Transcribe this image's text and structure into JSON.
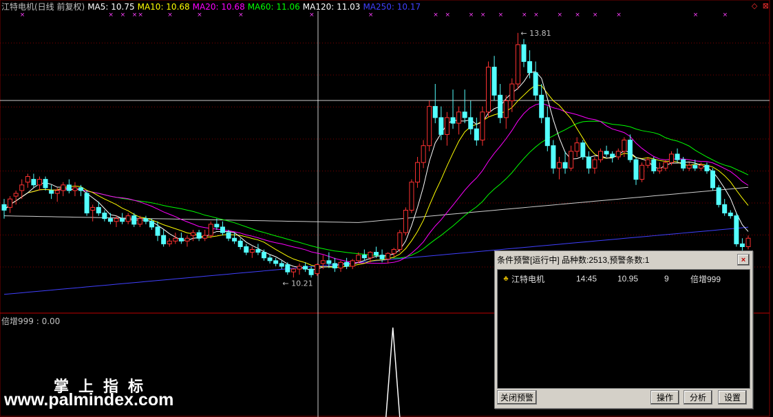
{
  "legend": {
    "stock": "江特电机(日线 前复权)",
    "ma": [
      {
        "label": "MA5: 10.75",
        "color": "#ffffff"
      },
      {
        "label": "MA10: 10.68",
        "color": "#ffff00"
      },
      {
        "label": "MA20: 10.68",
        "color": "#ff00ff"
      },
      {
        "label": "MA60: 11.06",
        "color": "#00ff00"
      },
      {
        "label": "MA120: 11.03",
        "color": "#ffffff"
      },
      {
        "label": "MA250: 10.17",
        "color": "#4040ff"
      }
    ]
  },
  "corner_icons": "◇ ⊠",
  "price_annotations": {
    "high": "13.81",
    "low": "10.21"
  },
  "sub_indicator": {
    "label": "倍增999 : 0.00"
  },
  "watermark": {
    "cn": "掌上指标",
    "url": "www.palmindex.com"
  },
  "alert_window": {
    "title": "条件预警[运行中] 品种数:2513,预警条数:1",
    "close_label": "×",
    "rows": [
      {
        "icon": "bell-icon",
        "name": "江特电机",
        "time": "14:45",
        "price": "10.95",
        "count": "9",
        "indicator": "倍增999"
      }
    ],
    "buttons": {
      "close_alert": "关闭预警",
      "operate": "操作",
      "analyze": "分析",
      "settings": "设置"
    }
  },
  "colors": {
    "up": "#ff3232",
    "down": "#54ffff",
    "background": "#000000",
    "grid": "#800000",
    "crosshair": "#ffffff"
  },
  "chart_data": {
    "type": "candlestick",
    "candles": [
      [
        10.75,
        10.85,
        10.5,
        10.65
      ],
      [
        10.7,
        10.9,
        10.6,
        10.85
      ],
      [
        10.9,
        11.0,
        10.75,
        10.95
      ],
      [
        11.0,
        11.2,
        10.85,
        11.1
      ],
      [
        11.15,
        11.3,
        11.05,
        11.25
      ],
      [
        11.2,
        11.3,
        11.05,
        11.1
      ],
      [
        11.1,
        11.25,
        11.0,
        11.2
      ],
      [
        11.2,
        11.25,
        11.0,
        11.05
      ],
      [
        11.0,
        11.1,
        10.85,
        10.95
      ],
      [
        10.95,
        11.05,
        10.8,
        11.0
      ],
      [
        11.0,
        11.15,
        10.9,
        11.1
      ],
      [
        11.1,
        11.2,
        10.95,
        11.0
      ],
      [
        11.0,
        11.15,
        10.9,
        11.05
      ],
      [
        11.05,
        11.1,
        10.9,
        11.0
      ],
      [
        10.95,
        11.0,
        10.55,
        10.6
      ],
      [
        10.65,
        10.75,
        10.45,
        10.7
      ],
      [
        10.7,
        10.8,
        10.55,
        10.6
      ],
      [
        10.6,
        10.65,
        10.45,
        10.5
      ],
      [
        10.5,
        10.6,
        10.4,
        10.45
      ],
      [
        10.45,
        10.55,
        10.35,
        10.5
      ],
      [
        10.5,
        10.6,
        10.4,
        10.45
      ],
      [
        10.45,
        10.6,
        10.4,
        10.55
      ],
      [
        10.55,
        10.6,
        10.35,
        10.4
      ],
      [
        10.4,
        10.55,
        10.35,
        10.5
      ],
      [
        10.5,
        10.55,
        10.4,
        10.45
      ],
      [
        10.45,
        10.5,
        10.3,
        10.35
      ],
      [
        10.35,
        10.45,
        10.1,
        10.2
      ],
      [
        10.2,
        10.3,
        10.0,
        10.05
      ],
      [
        10.05,
        10.15,
        10.0,
        10.1
      ],
      [
        10.1,
        10.25,
        10.05,
        10.15
      ],
      [
        10.15,
        10.25,
        10.05,
        10.1
      ],
      [
        10.1,
        10.2,
        10.0,
        10.15
      ],
      [
        10.2,
        10.3,
        10.1,
        10.25
      ],
      [
        10.25,
        10.3,
        10.1,
        10.15
      ],
      [
        10.15,
        10.3,
        10.1,
        10.2
      ],
      [
        10.2,
        10.45,
        10.15,
        10.4
      ],
      [
        10.4,
        10.5,
        10.3,
        10.35
      ],
      [
        10.35,
        10.45,
        10.2,
        10.25
      ],
      [
        10.25,
        10.3,
        10.1,
        10.15
      ],
      [
        10.15,
        10.25,
        10.05,
        10.1
      ],
      [
        10.1,
        10.15,
        9.95,
        10.0
      ],
      [
        10.0,
        10.05,
        9.85,
        9.9
      ],
      [
        9.9,
        10.0,
        9.8,
        9.95
      ],
      [
        9.95,
        10.05,
        9.85,
        9.9
      ],
      [
        9.9,
        9.95,
        9.75,
        9.8
      ],
      [
        9.8,
        9.85,
        9.7,
        9.75
      ],
      [
        9.75,
        9.8,
        9.65,
        9.7
      ],
      [
        9.7,
        9.75,
        9.6,
        9.65
      ],
      [
        9.68,
        9.72,
        9.5,
        9.55
      ],
      [
        9.55,
        9.62,
        9.45,
        9.6
      ],
      [
        9.6,
        9.7,
        9.5,
        9.65
      ],
      [
        9.65,
        9.72,
        9.55,
        9.6
      ],
      [
        9.6,
        9.65,
        9.45,
        9.5
      ],
      [
        9.52,
        9.7,
        9.48,
        9.68
      ],
      [
        9.7,
        9.85,
        9.6,
        9.75
      ],
      [
        9.75,
        9.9,
        9.62,
        9.7
      ],
      [
        9.7,
        9.8,
        9.55,
        9.62
      ],
      [
        9.62,
        9.75,
        9.55,
        9.72
      ],
      [
        9.72,
        9.8,
        9.6,
        9.65
      ],
      [
        9.65,
        9.78,
        9.6,
        9.75
      ],
      [
        9.75,
        9.9,
        9.7,
        9.85
      ],
      [
        9.85,
        9.95,
        9.75,
        9.8
      ],
      [
        9.8,
        9.92,
        9.72,
        9.9
      ],
      [
        9.9,
        10.0,
        9.8,
        9.85
      ],
      [
        9.85,
        9.95,
        9.72,
        9.78
      ],
      [
        9.78,
        9.9,
        9.7,
        9.88
      ],
      [
        9.88,
        9.98,
        9.8,
        9.95
      ],
      [
        9.95,
        10.3,
        9.9,
        10.25
      ],
      [
        10.25,
        10.7,
        10.2,
        10.65
      ],
      [
        10.65,
        11.2,
        10.6,
        11.15
      ],
      [
        11.15,
        11.6,
        11.05,
        11.5
      ],
      [
        11.5,
        11.9,
        11.4,
        11.8
      ],
      [
        11.8,
        12.6,
        11.7,
        12.5
      ],
      [
        12.5,
        12.9,
        12.2,
        12.3
      ],
      [
        12.3,
        12.5,
        11.9,
        12.0
      ],
      [
        12.0,
        12.4,
        11.8,
        12.3
      ],
      [
        12.3,
        12.8,
        12.1,
        12.2
      ],
      [
        12.2,
        12.5,
        12.0,
        12.4
      ],
      [
        12.4,
        12.8,
        12.2,
        12.3
      ],
      [
        12.3,
        12.6,
        12.0,
        12.1
      ],
      [
        12.1,
        12.3,
        11.8,
        11.9
      ],
      [
        11.9,
        12.5,
        11.8,
        12.4
      ],
      [
        12.4,
        13.3,
        12.3,
        13.2
      ],
      [
        13.2,
        13.4,
        12.6,
        12.7
      ],
      [
        12.7,
        12.9,
        12.2,
        12.3
      ],
      [
        12.3,
        12.7,
        12.1,
        12.6
      ],
      [
        12.6,
        13.0,
        12.4,
        12.9
      ],
      [
        12.9,
        13.81,
        12.8,
        13.6
      ],
      [
        13.6,
        13.7,
        13.2,
        13.3
      ],
      [
        13.3,
        13.5,
        13.0,
        13.1
      ],
      [
        13.1,
        13.3,
        12.6,
        12.7
      ],
      [
        12.7,
        12.9,
        12.2,
        12.3
      ],
      [
        12.3,
        12.5,
        11.7,
        11.8
      ],
      [
        11.8,
        11.9,
        11.3,
        11.4
      ],
      [
        11.4,
        11.6,
        11.2,
        11.5
      ],
      [
        11.5,
        11.7,
        11.3,
        11.4
      ],
      [
        11.4,
        11.8,
        11.35,
        11.7
      ],
      [
        11.7,
        11.95,
        11.6,
        11.85
      ],
      [
        11.85,
        11.9,
        11.55,
        11.6
      ],
      [
        11.6,
        11.7,
        11.3,
        11.4
      ],
      [
        11.4,
        11.6,
        11.3,
        11.55
      ],
      [
        11.55,
        11.75,
        11.5,
        11.7
      ],
      [
        11.7,
        11.8,
        11.6,
        11.65
      ],
      [
        11.65,
        11.7,
        11.5,
        11.6
      ],
      [
        11.6,
        11.75,
        11.55,
        11.7
      ],
      [
        11.7,
        11.95,
        11.6,
        11.9
      ],
      [
        11.9,
        12.0,
        11.5,
        11.55
      ],
      [
        11.55,
        11.6,
        11.1,
        11.2
      ],
      [
        11.2,
        11.5,
        11.15,
        11.45
      ],
      [
        11.45,
        11.6,
        11.4,
        11.55
      ],
      [
        11.55,
        11.6,
        11.3,
        11.35
      ],
      [
        11.35,
        11.5,
        11.3,
        11.4
      ],
      [
        11.4,
        11.55,
        11.35,
        11.5
      ],
      [
        11.5,
        11.7,
        11.45,
        11.65
      ],
      [
        11.65,
        11.75,
        11.5,
        11.55
      ],
      [
        11.55,
        11.6,
        11.35,
        11.4
      ],
      [
        11.4,
        11.5,
        11.35,
        11.45
      ],
      [
        11.45,
        11.55,
        11.35,
        11.4
      ],
      [
        11.4,
        11.5,
        11.35,
        11.45
      ],
      [
        11.45,
        11.5,
        11.3,
        11.35
      ],
      [
        11.35,
        11.4,
        11.0,
        11.05
      ],
      [
        11.05,
        11.1,
        10.7,
        10.75
      ],
      [
        10.75,
        10.85,
        10.55,
        10.6
      ],
      [
        10.6,
        10.65,
        10.5,
        10.55
      ],
      [
        10.55,
        10.6,
        10.0,
        10.05
      ],
      [
        10.05,
        10.15,
        9.85,
        10.0
      ],
      [
        10.0,
        10.2,
        9.95,
        10.15
      ]
    ],
    "ma_periods": [
      5,
      10,
      20,
      60,
      120,
      250
    ],
    "price_range": [
      9.0,
      14.2
    ],
    "sub_spike_index": 60,
    "signal_marks": [
      3,
      18,
      20,
      22,
      23,
      28,
      33,
      40,
      52,
      62,
      73,
      75,
      79,
      81,
      84,
      88,
      90,
      94,
      97,
      100,
      104,
      117,
      122
    ],
    "grid": true
  }
}
